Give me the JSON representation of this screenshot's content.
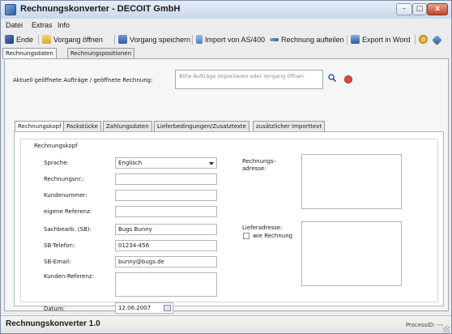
{
  "window": {
    "title": "Rechnungskonverter - DECOIT GmbH",
    "controls": {
      "minimize": "–",
      "maximize": "□",
      "close": "x"
    }
  },
  "menu": [
    {
      "label": "Datei"
    },
    {
      "label": "Extras"
    },
    {
      "label": "Info"
    }
  ],
  "toolbar": {
    "end": "Ende",
    "open": "Vorgang öffnen",
    "save": "Vorgang speichern",
    "import": "Import von AS/400",
    "split": "Rechnung aufteilen",
    "export": "Export in Word"
  },
  "main_tabs": [
    "Rechnungsdaten",
    "Rechnungspositionen"
  ],
  "open_orders": {
    "label": "Aktuell geöffnete Aufträge / geöffnete Rechnung:",
    "placeholder": "Bitte Aufträge importieren oder Vorgang öffnen."
  },
  "sub_tabs": [
    "Rechnungskopf",
    "Packstücke",
    "Zahlungsdaten",
    "Lieferbedingungen/Zusatztexte",
    "zusätzlicher Importtext"
  ],
  "form": {
    "group_title": "Rechnungskopf",
    "language_label": "Sprache:",
    "language_value": "Englisch",
    "invoice_no_label": "Rechnungsnr.:",
    "invoice_no_value": "",
    "customer_no_label": "Kundenummer:",
    "customer_no_value": "",
    "own_ref_label": "eigene Referenz:",
    "own_ref_value": "",
    "clerk_label": "Sachbearb. (SB):",
    "clerk_value": "Bugs Bunny",
    "phone_label": "SB-Telefon:",
    "phone_value": "01234-456",
    "email_label": "SB-Email:",
    "email_value": "bunny@bugs.de",
    "customer_ref_label": "Kunden-Referenz:",
    "customer_ref_value": "",
    "date_label": "Datum:",
    "date_value": "12.06.2007",
    "billing_address_label": "Rechnungs-\nadresse:",
    "delivery_address_label": "Lieferadresse:",
    "same_as_invoice_label": "wie Rechnung",
    "same_as_invoice_checked": false
  },
  "status": {
    "left": "Rechnungskonverter 1.0",
    "right": "ProcessID: ---"
  }
}
